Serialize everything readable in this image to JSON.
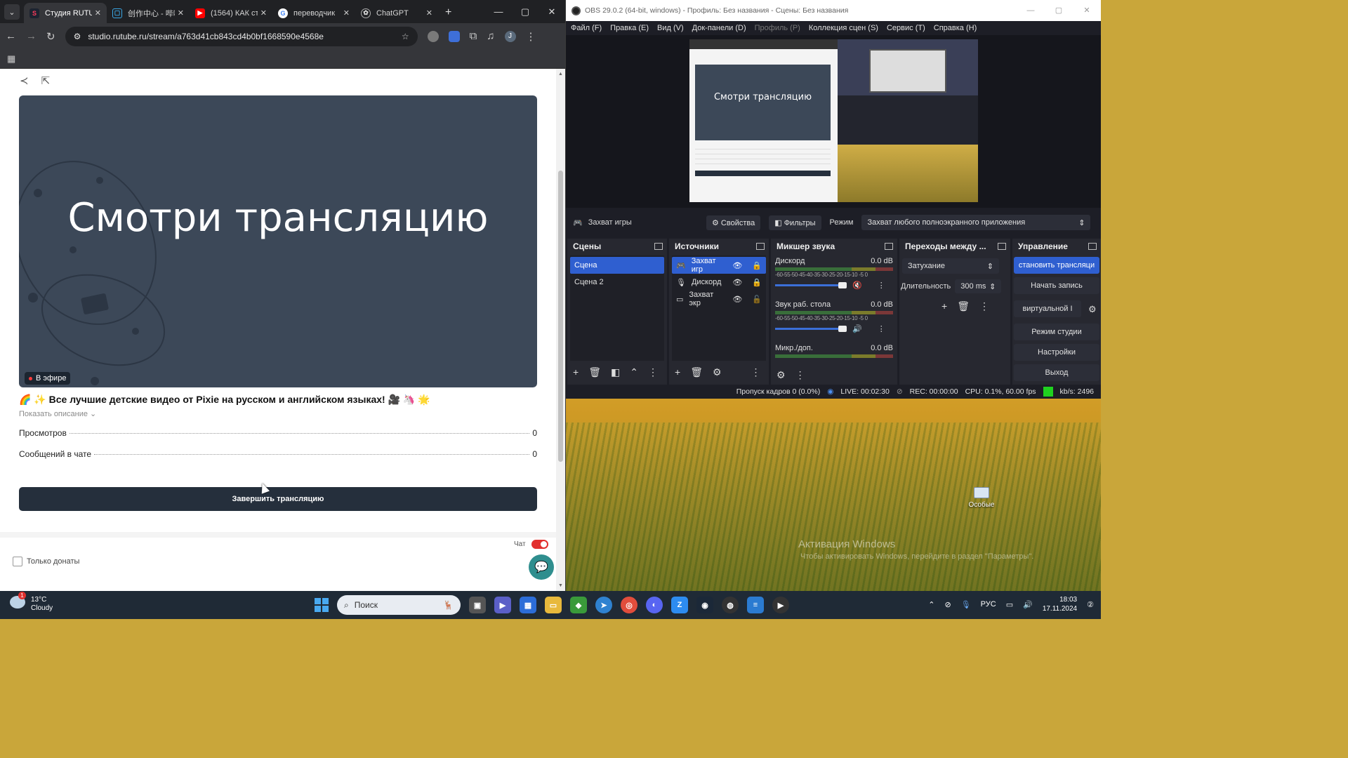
{
  "browser": {
    "tabs": [
      {
        "title": "Студия RUTUBE",
        "favicon": "rutube-icon",
        "active": true
      },
      {
        "title": "创作中心 - 哔哩",
        "favicon": "bilibili-icon"
      },
      {
        "title": "(1564) КАК ст",
        "favicon": "youtube-icon"
      },
      {
        "title": "переводчик",
        "favicon": "google-icon"
      },
      {
        "title": "ChatGPT",
        "favicon": "chatgpt-icon"
      }
    ],
    "url": "studio.rutube.ru/stream/a763d41cb843cd4b0bf1668590e4568e",
    "profile_letter": "J"
  },
  "rutube": {
    "preview_text": "Смотри трансляцию",
    "live_badge": "В эфире",
    "stream_title": "🌈 ✨ Все лучшие детские видео от Pixie на русском и английском языках! 🎥 🦄 🌟",
    "show_description": "Показать описание ⌄",
    "stats": [
      {
        "label": "Просмотров",
        "value": "0"
      },
      {
        "label": "Сообщений в чате",
        "value": "0"
      }
    ],
    "end_button": "Завершить трансляцию",
    "chat_label": "Чат",
    "chat_enabled": true,
    "donations_only": "Только донаты"
  },
  "obs": {
    "title": "OBS 29.0.2 (64-bit, windows) - Профиль: Без названия - Сцены: Без названия",
    "menu": [
      "Файл (F)",
      "Правка (E)",
      "Вид (V)",
      "Док-панели (D)",
      "Профиль (P)",
      "Коллекция сцен (S)",
      "Сервис (T)",
      "Справка (H)"
    ],
    "source_bar": {
      "source": "Захват игры",
      "properties": "Свойства",
      "filters": "Фильтры",
      "mode_label": "Режим",
      "mode_value": "Захват любого полноэкранного приложения"
    },
    "scenes": {
      "title": "Сцены",
      "items": [
        "Сцена",
        "Сцена 2"
      ]
    },
    "sources": {
      "title": "Источники",
      "items": [
        "Захват игр",
        "Дискорд",
        "Захват экр"
      ]
    },
    "mixer": {
      "title": "Микшер звука",
      "scale": "-60-55-50-45-40-35-30-25-20-15-10 -5 0",
      "channels": [
        {
          "name": "Дискорд",
          "level": "0.0 dB",
          "muted": true
        },
        {
          "name": "Звук раб. стола",
          "level": "0.0 dB",
          "muted": false
        },
        {
          "name": "Микр./доп.",
          "level": "0.0 dB"
        }
      ]
    },
    "transitions": {
      "title": "Переходы между ...",
      "type": "Затухание",
      "duration_label": "Длительность",
      "duration_value": "300 ms"
    },
    "controls": {
      "title": "Управление",
      "buttons": [
        "становить трансляци",
        "Начать запись",
        "виртуальной I",
        "Режим студии",
        "Настройки",
        "Выход"
      ]
    },
    "status": {
      "dropped": "Пропуск кадров 0 (0.0%)",
      "live": "LIVE: 00:02:30",
      "rec": "REC: 00:00:00",
      "cpu": "CPU: 0.1%, 60.00 fps",
      "kbps": "kb/s: 2496"
    },
    "canvas_text": "Смотри трансляцию"
  },
  "desktop": {
    "icon_label": "Особые",
    "activation_title": "Активация Windows",
    "activation_sub": "Чтобы активировать Windows, перейдите в раздел \"Параметры\"."
  },
  "taskbar": {
    "temperature": "13°C",
    "weather": "Cloudy",
    "search_placeholder": "Поиск",
    "language": "РУС",
    "time": "18:03",
    "date": "17.11.2024"
  },
  "colors": {
    "obs_accent": "#2f5fd0",
    "rutube_dark": "#252f3c",
    "live_red": "#ff3b3b"
  }
}
